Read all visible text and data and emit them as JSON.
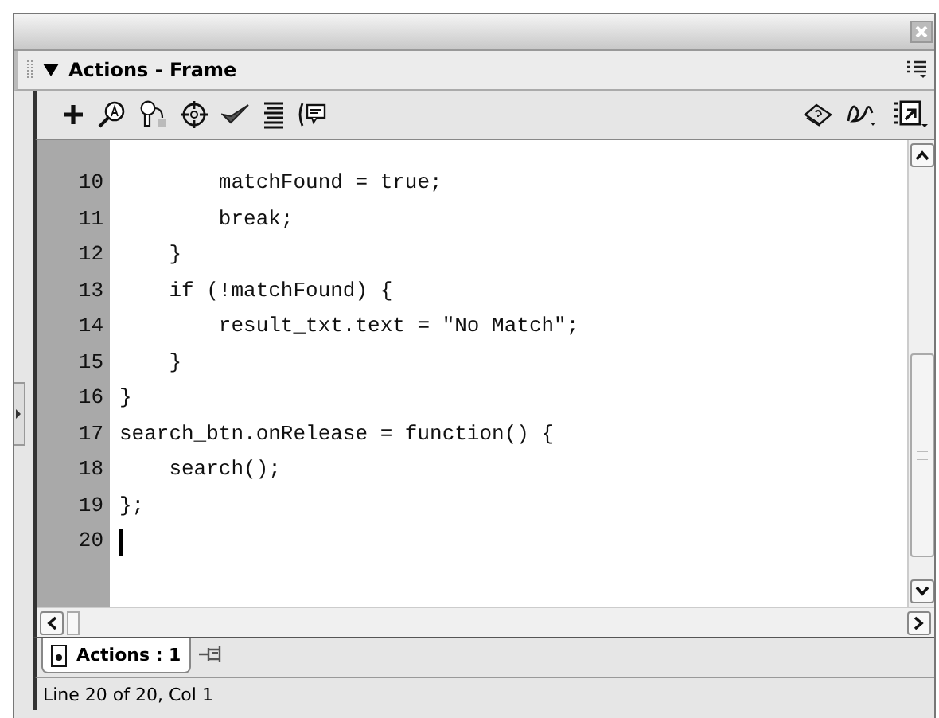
{
  "panel": {
    "title": "Actions - Frame",
    "expanded": true
  },
  "code": {
    "lines": [
      {
        "number": "10",
        "text": "        matchFound = true;",
        "cursor": false
      },
      {
        "number": "11",
        "text": "        break;",
        "cursor": false
      },
      {
        "number": "12",
        "text": "    }",
        "cursor": false
      },
      {
        "number": "13",
        "text": "    if (!matchFound) {",
        "cursor": false
      },
      {
        "number": "14",
        "text": "        result_txt.text = \"No Match\";",
        "cursor": false
      },
      {
        "number": "15",
        "text": "    }",
        "cursor": false
      },
      {
        "number": "16",
        "text": "}",
        "cursor": false
      },
      {
        "number": "17",
        "text": "search_btn.onRelease = function() {",
        "cursor": false
      },
      {
        "number": "18",
        "text": "    search();",
        "cursor": false
      },
      {
        "number": "19",
        "text": "};",
        "cursor": false
      },
      {
        "number": "20",
        "cursor": true
      }
    ]
  },
  "tabs": [
    {
      "label": "Actions : 1",
      "selected": true
    }
  ],
  "status_bar": "Line 20 of 20, Col 1"
}
